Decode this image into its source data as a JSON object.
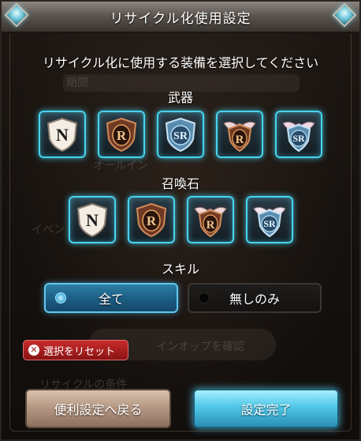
{
  "dialog": {
    "title": "リサイクル化使用設定",
    "instruction": "リサイクル化に使用する装備を選択してください"
  },
  "background_ghost": {
    "line1": "期間",
    "line2": "オールイン",
    "line3": "イベント",
    "line4": "インオップを確認",
    "line5": "リサイクルの条件"
  },
  "weapon": {
    "label": "武器",
    "items": [
      {
        "rarity": "N",
        "selected": true
      },
      {
        "rarity": "R",
        "selected": true
      },
      {
        "rarity": "SR",
        "selected": true
      },
      {
        "rarity": "R",
        "selected": true
      },
      {
        "rarity": "SR",
        "selected": true
      }
    ]
  },
  "summon": {
    "label": "召喚石",
    "items": [
      {
        "rarity": "N",
        "selected": true
      },
      {
        "rarity": "R",
        "selected": true
      },
      {
        "rarity": "R",
        "selected": true
      },
      {
        "rarity": "SR",
        "selected": true
      }
    ]
  },
  "skill": {
    "label": "スキル",
    "options": [
      {
        "label": "全て",
        "selected": true
      },
      {
        "label": "無しのみ",
        "selected": false
      }
    ]
  },
  "reset": {
    "label": "選択をリセット"
  },
  "footer": {
    "back_label": "便利設定へ戻る",
    "done_label": "設定完了"
  },
  "colors": {
    "selected_glow": "#47d4ee",
    "reset_red": "#c72c2c",
    "done_cyan": "#4fc7e6",
    "back_tan": "#b69a85"
  }
}
